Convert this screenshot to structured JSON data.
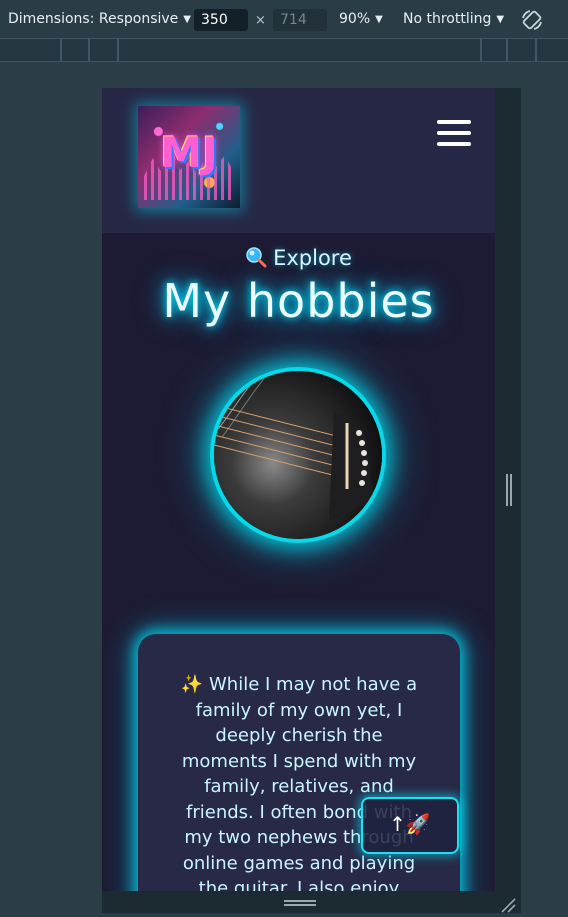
{
  "devtools": {
    "dimensions_label": "Dimensions: Responsive",
    "width_value": "350",
    "height_value": "714",
    "times_sign": "×",
    "zoom": "90%",
    "throttling": "No throttling",
    "rotate_icon": "rotate-icon"
  },
  "site": {
    "logo_text": "MJ",
    "menu_icon": "hamburger-menu-icon",
    "explore_label": "Explore",
    "explore_icon": "magnifier-icon",
    "title": "My hobbies",
    "hobby_image": "guitar-photo",
    "card_text": "✨ While I may not have a family of my own yet, I deeply cherish the moments I spend with my family, relatives, and friends. I often bond with my two nephews through online games and playing the guitar. I also enjoy",
    "back_to_top_label": "↑🚀"
  },
  "colors": {
    "page_bg": "#1d1b33",
    "header_bg": "#262745",
    "neon_cyan": "#00e8ff",
    "devtools_bg": "#2a3d47"
  }
}
